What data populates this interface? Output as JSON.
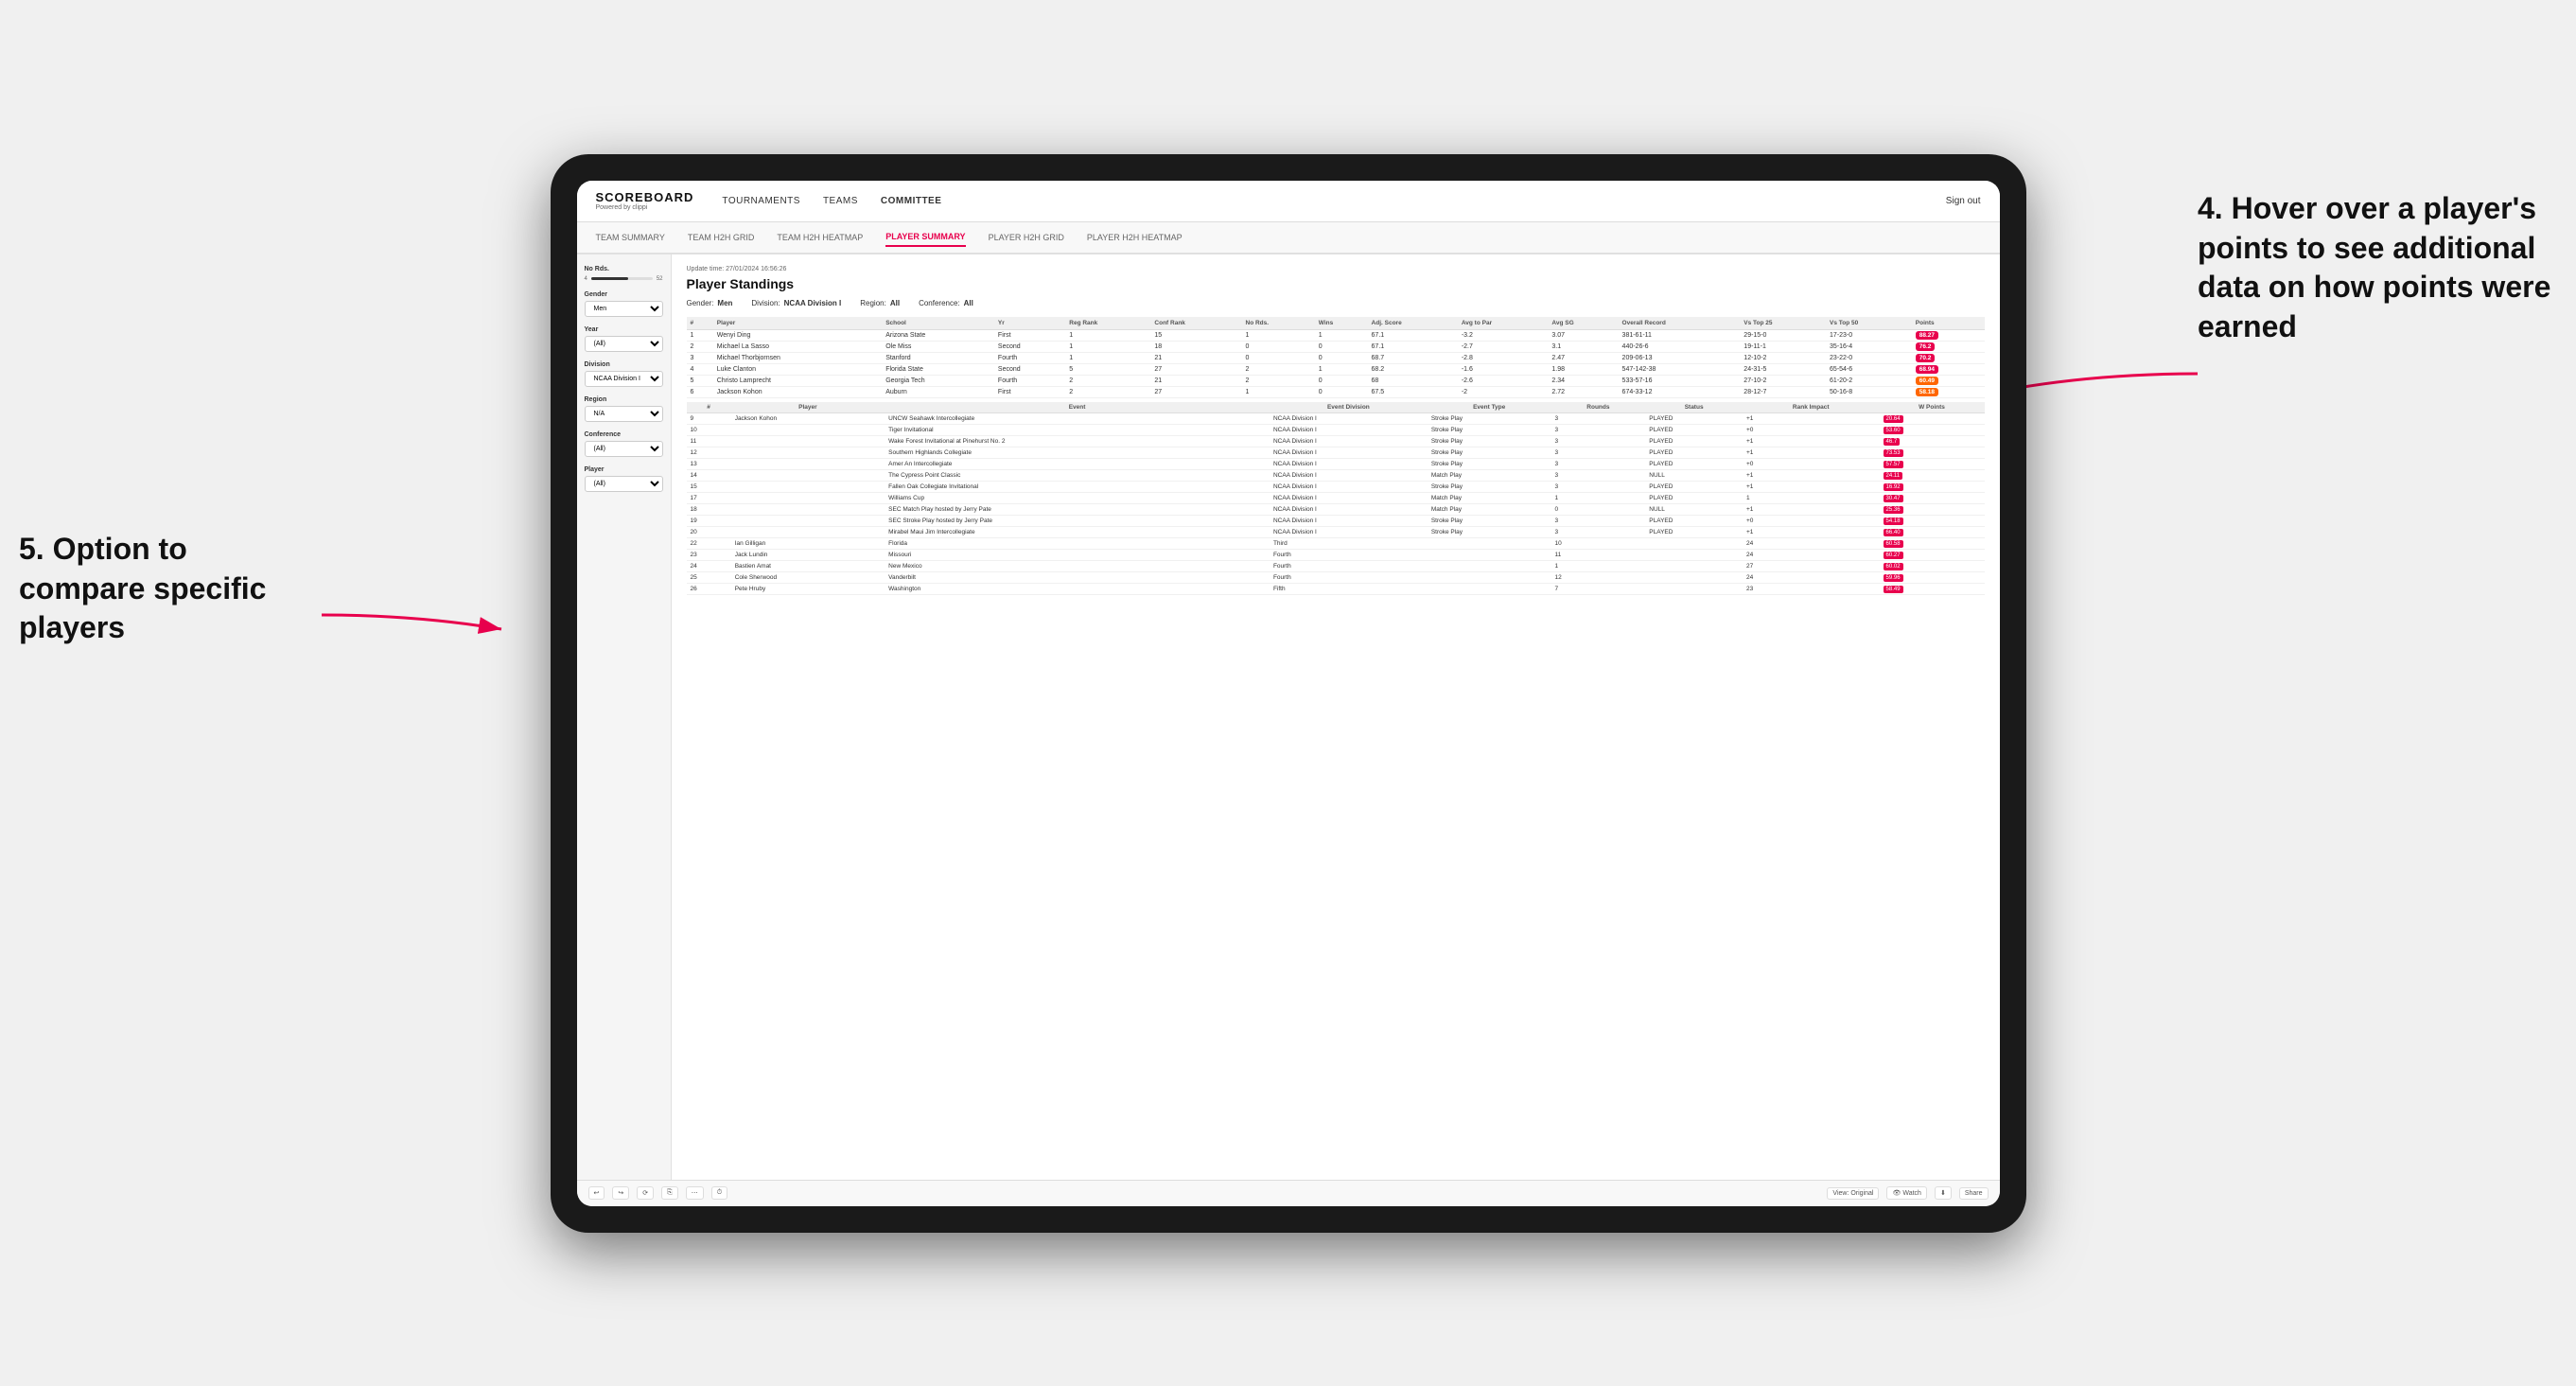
{
  "nav": {
    "logo": "SCOREBOARD",
    "logo_sub": "Powered by clippi",
    "links": [
      "TOURNAMENTS",
      "TEAMS",
      "COMMITTEE"
    ],
    "sign_out": "Sign out"
  },
  "sub_tabs": [
    {
      "label": "TEAM SUMMARY",
      "active": false
    },
    {
      "label": "TEAM H2H GRID",
      "active": false
    },
    {
      "label": "TEAM H2H HEATMAP",
      "active": false
    },
    {
      "label": "PLAYER SUMMARY",
      "active": true
    },
    {
      "label": "PLAYER H2H GRID",
      "active": false
    },
    {
      "label": "PLAYER H2H HEATMAP",
      "active": false
    }
  ],
  "sidebar": {
    "no_rds_label": "No Rds.",
    "no_rds_min": "4",
    "no_rds_max": "52",
    "gender_label": "Gender",
    "gender_value": "Men",
    "year_label": "Year",
    "year_value": "(All)",
    "division_label": "Division",
    "division_value": "NCAA Division I",
    "region_label": "Region",
    "region_value": "N/A",
    "conference_label": "Conference",
    "conference_value": "(All)",
    "player_label": "Player",
    "player_value": "(All)"
  },
  "content": {
    "update_time": "Update time: 27/01/2024 16:56:26",
    "title": "Player Standings",
    "gender": "Men",
    "division": "NCAA Division I",
    "region": "All",
    "conference": "All",
    "table_headers": [
      "#",
      "Player",
      "School",
      "Yr",
      "Reg Rank",
      "Conf Rank",
      "No Rds.",
      "Wins",
      "Adj. Score",
      "Avg to Par",
      "Avg SG",
      "Overall Record",
      "Vs Top 25",
      "Vs Top 50",
      "Points"
    ],
    "players": [
      {
        "num": 1,
        "name": "Wenyi Ding",
        "school": "Arizona State",
        "yr": "First",
        "reg_rank": 1,
        "conf_rank": 15,
        "rds": 1,
        "wins": 1,
        "adj_score": 67.1,
        "to_par": -3.2,
        "avg_sg": 3.07,
        "record": "381-61-11",
        "vs25": "29-15-0",
        "vs50": "17-23-0",
        "points": "88.27",
        "points_color": "red"
      },
      {
        "num": 2,
        "name": "Michael La Sasso",
        "school": "Ole Miss",
        "yr": "Second",
        "reg_rank": 1,
        "conf_rank": 18,
        "rds": 0,
        "wins": 0,
        "adj_score": 67.1,
        "to_par": -2.7,
        "avg_sg": 3.1,
        "record": "440-26-6",
        "vs25": "19-11-1",
        "vs50": "35-16-4",
        "points": "76.2",
        "points_color": "red"
      },
      {
        "num": 3,
        "name": "Michael Thorbjornsen",
        "school": "Stanford",
        "yr": "Fourth",
        "reg_rank": 1,
        "conf_rank": 21,
        "rds": 0,
        "wins": 0,
        "adj_score": 68.7,
        "to_par": -2.8,
        "avg_sg": 2.47,
        "record": "209-06-13",
        "vs25": "12-10-2",
        "vs50": "23-22-0",
        "points": "70.2",
        "points_color": "red"
      },
      {
        "num": 4,
        "name": "Luke Clanton",
        "school": "Florida State",
        "yr": "Second",
        "reg_rank": 5,
        "conf_rank": 27,
        "rds": 2,
        "wins": 1,
        "adj_score": 68.2,
        "to_par": -1.6,
        "avg_sg": 1.98,
        "record": "547-142-38",
        "vs25": "24-31-5",
        "vs50": "65-54-6",
        "points": "68.94",
        "points_color": "red"
      },
      {
        "num": 5,
        "name": "Christo Lamprecht",
        "school": "Georgia Tech",
        "yr": "Fourth",
        "reg_rank": 2,
        "conf_rank": 21,
        "rds": 2,
        "wins": 0,
        "adj_score": 68.0,
        "to_par": -2.6,
        "avg_sg": 2.34,
        "record": "533-57-16",
        "vs25": "27-10-2",
        "vs50": "61-20-2",
        "points": "60.49",
        "points_color": "orange"
      },
      {
        "num": 6,
        "name": "Jackson Kohon",
        "school": "Auburn",
        "yr": "First",
        "reg_rank": 2,
        "conf_rank": 27,
        "rds": 1,
        "wins": 0,
        "adj_score": 67.5,
        "to_par": -2.0,
        "avg_sg": 2.72,
        "record": "674-33-12",
        "vs25": "28-12-7",
        "vs50": "50-16-8",
        "points": "58.18",
        "points_color": "orange"
      }
    ],
    "hover_headers": [
      "#",
      "Player",
      "Event",
      "Event Division",
      "Event Type",
      "Rounds",
      "Status",
      "Rank Impact",
      "W Points"
    ],
    "hover_rows": [
      {
        "num": 9,
        "player": "Jackson Kohon",
        "event": "UNCW Seahawk Intercollegiate",
        "division": "NCAA Division I",
        "type": "Stroke Play",
        "rounds": 3,
        "status": "PLAYED",
        "rank_impact": "+1",
        "w_points": "20.64"
      },
      {
        "num": 10,
        "player": "",
        "event": "Tiger Invitational",
        "division": "NCAA Division I",
        "type": "Stroke Play",
        "rounds": 3,
        "status": "PLAYED",
        "rank_impact": "+0",
        "w_points": "53.60"
      },
      {
        "num": 11,
        "player": "",
        "event": "Wake Forest Invitational at Pinehurst No. 2",
        "division": "NCAA Division I",
        "type": "Stroke Play",
        "rounds": 3,
        "status": "PLAYED",
        "rank_impact": "+1",
        "w_points": "46.7"
      },
      {
        "num": 12,
        "player": "",
        "event": "Southern Highlands Collegiate",
        "division": "NCAA Division I",
        "type": "Stroke Play",
        "rounds": 3,
        "status": "PLAYED",
        "rank_impact": "+1",
        "w_points": "73.53"
      },
      {
        "num": 13,
        "player": "",
        "event": "Amer An Intercollegiate",
        "division": "NCAA Division I",
        "type": "Stroke Play",
        "rounds": 3,
        "status": "PLAYED",
        "rank_impact": "+0",
        "w_points": "57.57"
      },
      {
        "num": 14,
        "player": "",
        "event": "The Cypress Point Classic",
        "division": "NCAA Division I",
        "type": "Match Play",
        "rounds": 3,
        "status": "NULL",
        "rank_impact": "+1",
        "w_points": "24.11"
      },
      {
        "num": 15,
        "player": "",
        "event": "Fallen Oak Collegiate Invitational",
        "division": "NCAA Division I",
        "type": "Stroke Play",
        "rounds": 3,
        "status": "PLAYED",
        "rank_impact": "+1",
        "w_points": "16.92"
      },
      {
        "num": 17,
        "player": "",
        "event": "Williams Cup",
        "division": "NCAA Division I",
        "type": "Match Play",
        "rounds": 1,
        "status": "PLAYED",
        "rank_impact": "1",
        "w_points": "30.47"
      },
      {
        "num": 18,
        "player": "",
        "event": "SEC Match Play hosted by Jerry Pate",
        "division": "NCAA Division I",
        "type": "Match Play",
        "rounds": 0,
        "status": "NULL",
        "rank_impact": "+1",
        "w_points": "25.36"
      },
      {
        "num": 19,
        "player": "",
        "event": "SEC Stroke Play hosted by Jerry Pate",
        "division": "NCAA Division I",
        "type": "Stroke Play",
        "rounds": 3,
        "status": "PLAYED",
        "rank_impact": "+0",
        "w_points": "54.18"
      },
      {
        "num": 20,
        "player": "",
        "event": "Mirabel Maui Jim Intercollegiate",
        "division": "NCAA Division I",
        "type": "Stroke Play",
        "rounds": 3,
        "status": "PLAYED",
        "rank_impact": "+1",
        "w_points": "66.40"
      },
      {
        "num": 22,
        "player": "Ian Gilligan",
        "event": "Florida",
        "division": "Third",
        "type": "",
        "rounds": 10,
        "status": "",
        "rank_impact": "24",
        "w_points": "60.58"
      },
      {
        "num": 23,
        "player": "Jack Lundin",
        "event": "Missouri",
        "division": "Fourth",
        "type": "",
        "rounds": 11,
        "status": "",
        "rank_impact": "24",
        "w_points": "60.27"
      },
      {
        "num": 24,
        "player": "Bastien Amat",
        "event": "New Mexico",
        "division": "Fourth",
        "type": "",
        "rounds": 1,
        "status": "",
        "rank_impact": "27",
        "w_points": "60.02"
      },
      {
        "num": 25,
        "player": "Cole Sherwood",
        "event": "Vanderbilt",
        "division": "Fourth",
        "type": "",
        "rounds": 12,
        "status": "",
        "rank_impact": "24",
        "w_points": "59.96"
      },
      {
        "num": 26,
        "player": "Pete Hruby",
        "event": "Washington",
        "division": "Fifth",
        "type": "",
        "rounds": 7,
        "status": "",
        "rank_impact": "23",
        "w_points": "58.49"
      }
    ]
  },
  "toolbar": {
    "view_label": "View: Original",
    "watch_label": "Watch",
    "share_label": "Share"
  },
  "annotations": {
    "right_title": "4. Hover over a player's points to see additional data on how points were earned",
    "left_title": "5. Option to compare specific players"
  }
}
